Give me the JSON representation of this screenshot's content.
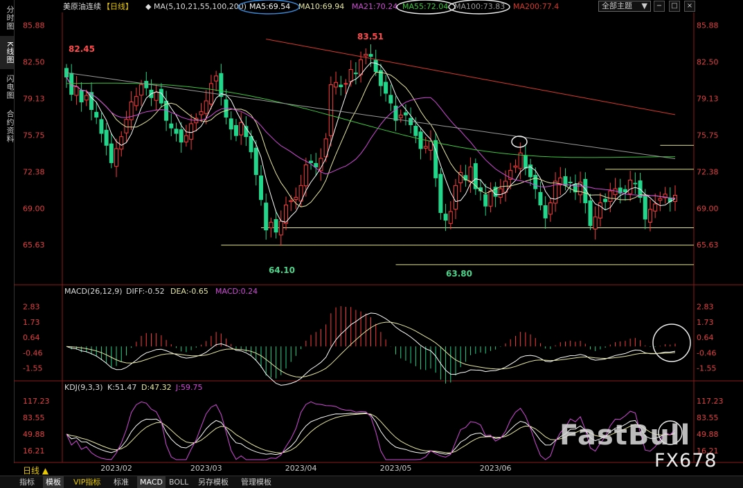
{
  "left_tabs": [
    "分时图",
    "K线图",
    "闪电图",
    "合约资料"
  ],
  "header": {
    "symbol": "美原油连续",
    "period": "【日线】",
    "ma_params": "MA(5,10,21,55,100,200)",
    "ma5": "MA5:69.54",
    "ma10": "MA10:69.94",
    "ma21": "MA21:70.24",
    "ma55": "MA55:72.04",
    "ma100": "MA100:73.83",
    "ma200": "MA200:77.4",
    "theme": "全部主题",
    "theme_arrow": "▼"
  },
  "macd_header": {
    "params": "MACD(26,12,9)",
    "diff": "DIFF:-0.52",
    "dea": "DEA:-0.65",
    "macd": "MACD:0.24"
  },
  "kdj_header": {
    "params": "KDJ(9,3,3)",
    "k": "K:51.47",
    "d": "D:47.32",
    "j": "J:59.75"
  },
  "period_label": "日线 ▲",
  "bottom_tabs": [
    "指标",
    "模板",
    "VIP指标",
    "标准",
    "MACD",
    "BOLL",
    "另存模板",
    "管理模板"
  ],
  "watermark": {
    "brand": "FastBull",
    "sub": "FX678"
  },
  "colors": {
    "up": "#ff3b3b",
    "down": "#22d68b",
    "ma5": "#ffffff",
    "ma10": "#e8e8a0",
    "ma21": "#d24ad8",
    "ma55": "#3cc83c",
    "ma100": "#9a9a9a",
    "ma200": "#d8382a",
    "level": "#e8e890",
    "axis_label": "#e04040"
  },
  "chart_data": {
    "type": "candlestick",
    "price_axis": {
      "ylim": [
        62.2,
        86.8
      ],
      "ticks": [
        "85.88",
        "82.50",
        "79.13",
        "75.75",
        "72.38",
        "69.00",
        "65.63"
      ]
    },
    "macd_axis": {
      "ylim": [
        -2.4,
        3.4
      ],
      "ticks": [
        "2.83",
        "1.73",
        "0.64",
        "-0.46",
        "-1.55"
      ]
    },
    "kdj_axis": {
      "ylim": [
        -2,
        130
      ],
      "ticks": [
        "117.23",
        "83.55",
        "49.88",
        "16.21"
      ]
    },
    "x_labels": [
      "2023/02",
      "2023/03",
      "2023/04",
      "2023/05",
      "2023/06"
    ],
    "x_label_index": [
      10,
      28,
      47,
      66,
      86
    ],
    "annotations": {
      "high1": "82.45",
      "high2": "83.51",
      "low1": "64.10",
      "low2": "63.80"
    },
    "close": [
      81.1,
      79.5,
      80.2,
      78.8,
      79.4,
      78.1,
      77.4,
      75.9,
      74.8,
      73.2,
      74.5,
      75.6,
      77.2,
      78.8,
      79.3,
      80.4,
      80.1,
      79.2,
      79.7,
      78.7,
      77.1,
      76.4,
      75.9,
      75.1,
      75.7,
      76.8,
      77.3,
      77.9,
      78.9,
      80.5,
      81.2,
      79.3,
      77.4,
      76.3,
      75.7,
      76.9,
      75.6,
      74.2,
      72.1,
      69.8,
      67.0,
      67.7,
      66.8,
      67.8,
      69.3,
      69.7,
      70.0,
      71.1,
      73.0,
      73.2,
      72.8,
      73.6,
      75.4,
      80.4,
      80.6,
      80.2,
      80.5,
      81.8,
      81.4,
      82.7,
      83.2,
      83.0,
      81.6,
      80.3,
      79.6,
      78.7,
      77.1,
      77.6,
      77.6,
      76.7,
      75.7,
      74.5,
      74.7,
      75.2,
      71.8,
      68.6,
      67.9,
      68.7,
      71.1,
      72.3,
      71.6,
      72.8,
      70.8,
      70.6,
      69.2,
      70.6,
      70.1,
      70.8,
      71.5,
      72.5,
      72.9,
      74.1,
      72.7,
      71.9,
      70.8,
      69.3,
      68.1,
      69.5,
      71.5,
      71.8,
      71.1,
      71.4,
      70.5,
      71.4,
      69.5,
      67.4,
      68.2,
      69.5,
      69.6,
      70.6,
      70.8,
      70.4,
      70.5,
      71.6,
      71.3,
      70.0,
      68.0,
      68.9,
      69.4,
      69.9,
      70.3,
      69.6,
      70.2
    ]
  }
}
